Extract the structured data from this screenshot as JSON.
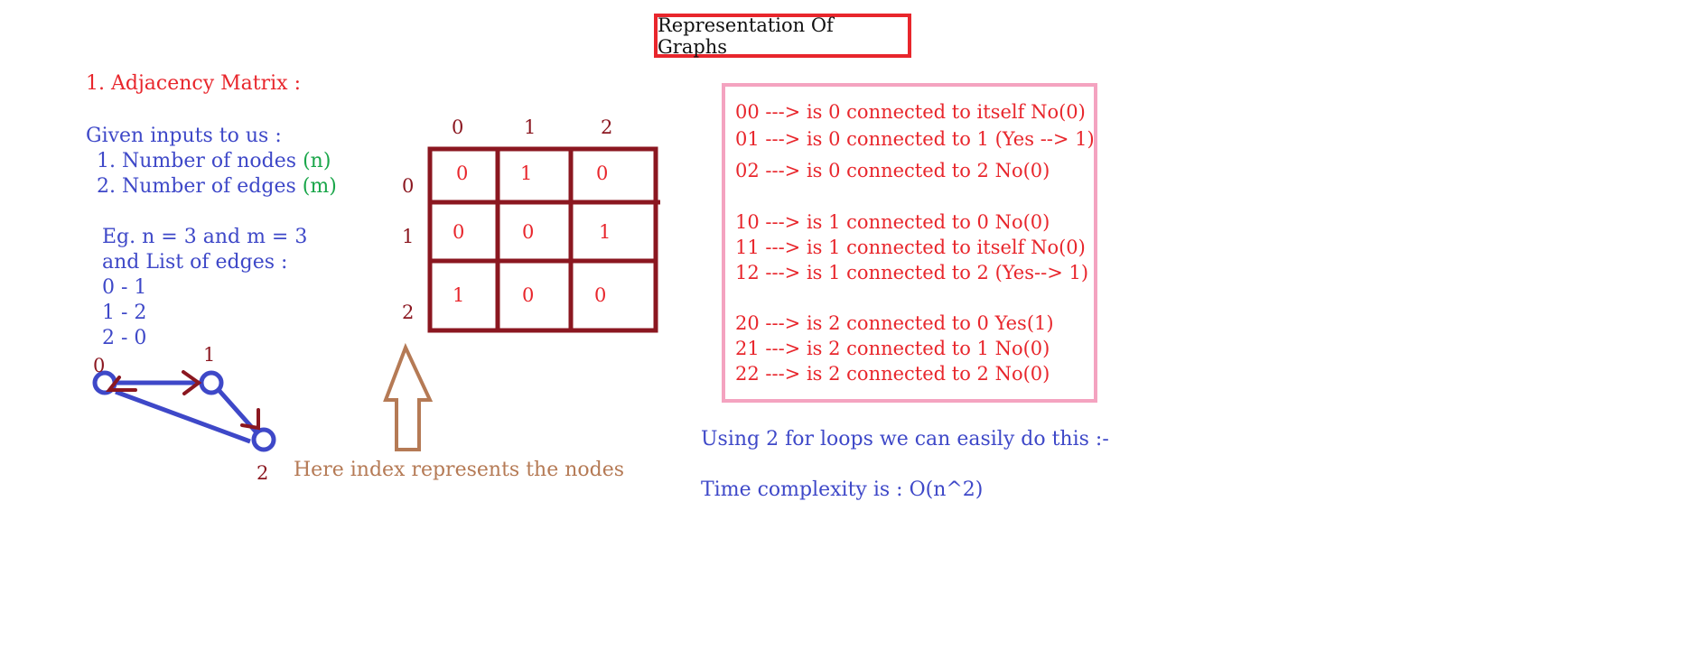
{
  "title": "Representation Of Graphs",
  "section_heading": "1. Adjacency Matrix :",
  "inputs": {
    "intro": "Given inputs to us :",
    "nodes_label": "1. Number of nodes",
    "nodes_var": "(n)",
    "edges_label": "2. Number of edges",
    "edges_var": "(m)"
  },
  "example": {
    "line1": "Eg. n = 3 and m = 3",
    "line2": "and List of edges :",
    "edges": [
      "0 - 1",
      "1 - 2",
      "2 - 0"
    ]
  },
  "graph": {
    "node_labels": [
      "0",
      "1",
      "2"
    ],
    "edges": [
      [
        "0",
        "1"
      ],
      [
        "1",
        "2"
      ],
      [
        "2",
        "0"
      ]
    ]
  },
  "matrix": {
    "col_headers": [
      "0",
      "1",
      "2"
    ],
    "row_headers": [
      "0",
      "1",
      "2"
    ],
    "cells": [
      [
        "0",
        "1",
        "0"
      ],
      [
        "0",
        "0",
        "1"
      ],
      [
        "1",
        "0",
        "0"
      ]
    ]
  },
  "arrow_note": "Here index represents the nodes",
  "rules": [
    "00 ---> is 0 connected to itself No(0)",
    "01 ---> is 0 connected to 1 (Yes --> 1)",
    "02 ---> is 0 connected to 2 No(0)",
    "10 ---> is 1 connected to 0 No(0)",
    "11 ---> is 1 connected to itself No(0)",
    "12 ---> is 1 connected to 2 (Yes--> 1)",
    "20 ---> is 2 connected to 0 Yes(1)",
    "21 ---> is 2 connected to 1 No(0)",
    "22 ---> is 2 connected to 2 No(0)"
  ],
  "loops_note": "Using 2 for loops we can easily do this :-",
  "complexity_note": "Time complexity is : O(n^2)",
  "colors": {
    "heading_red": "#e8262c",
    "text_blue": "#3e48c8",
    "var_green": "#1aa64a",
    "matrix_maroon": "#8b1720",
    "note_brown": "#b57a55",
    "box_pink": "#f4a3c0"
  }
}
